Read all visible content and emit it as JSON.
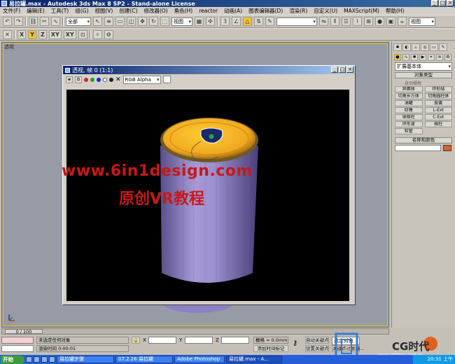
{
  "window": {
    "title": "易拉罐.max - Autodesk 3ds Max 8 SP2  - Stand-alone License"
  },
  "menu": [
    "文件(F)",
    "编辑(E)",
    "工具(T)",
    "组(G)",
    "视图(V)",
    "创建(C)",
    "修改器(O)",
    "角色(H)",
    "reactor",
    "动画(A)",
    "图表编辑器(D)",
    "渲染(R)",
    "自定义(U)",
    "MAXScript(M)",
    "帮助(H)"
  ],
  "toolbar": {
    "selection_filter": "全部",
    "ref_coord": "视图",
    "named_sel": "",
    "view_combo": "视图",
    "axis_buttons": [
      "X",
      "Y",
      "Z",
      "XY",
      "XY"
    ]
  },
  "viewport": {
    "label": "透视"
  },
  "render_window": {
    "title": "透视, 帧 0 (1:1)",
    "channel": "RGB Alpha",
    "watermark_url": "www.6in1design.com",
    "watermark_sub": "原创VR教程"
  },
  "command_panel": {
    "category": "扩展基本体",
    "rollout_object_type": "对象类型",
    "auto_grid": "自动栅格",
    "primitives": [
      "异面体",
      "环形结",
      "切角长方体",
      "切角圆柱体",
      "油罐",
      "胶囊",
      "纺锤",
      "L-Ext",
      "球棱柱",
      "C-Ext",
      "环形波",
      "棱柱",
      "软管"
    ],
    "rollout_name_color": "名称和颜色",
    "object_color": "#e06020"
  },
  "timeline": {
    "slider": "0 / 100"
  },
  "status": {
    "selection": "未选定任何对象",
    "render_time": "渲染时间  0:00:01",
    "x_label": "X",
    "y_label": "Y",
    "z_label": "Z",
    "grid": "栅格 = 0.0mm",
    "add_time_tag": "添加时间标记",
    "auto_key": "自动关键点",
    "set_key": "设置关键点",
    "selected": "选定对象",
    "key_filters": "关键点过滤器..."
  },
  "taskbar": {
    "start": "开始",
    "tasks": [
      "易拉罐步骤",
      "07.2.26 易拉罐",
      "Adobe Photoshop",
      "易拉罐.max - A..."
    ],
    "clock": "20:31 上午"
  },
  "watermark": {
    "brand": "CG时代",
    "site": "www.cgtimes.com.cn"
  },
  "colors": {
    "viewport_bg": "#969ba5",
    "lid": "#f5b324",
    "can_body": "#8d80c6",
    "watermark_red": "#c81818"
  }
}
